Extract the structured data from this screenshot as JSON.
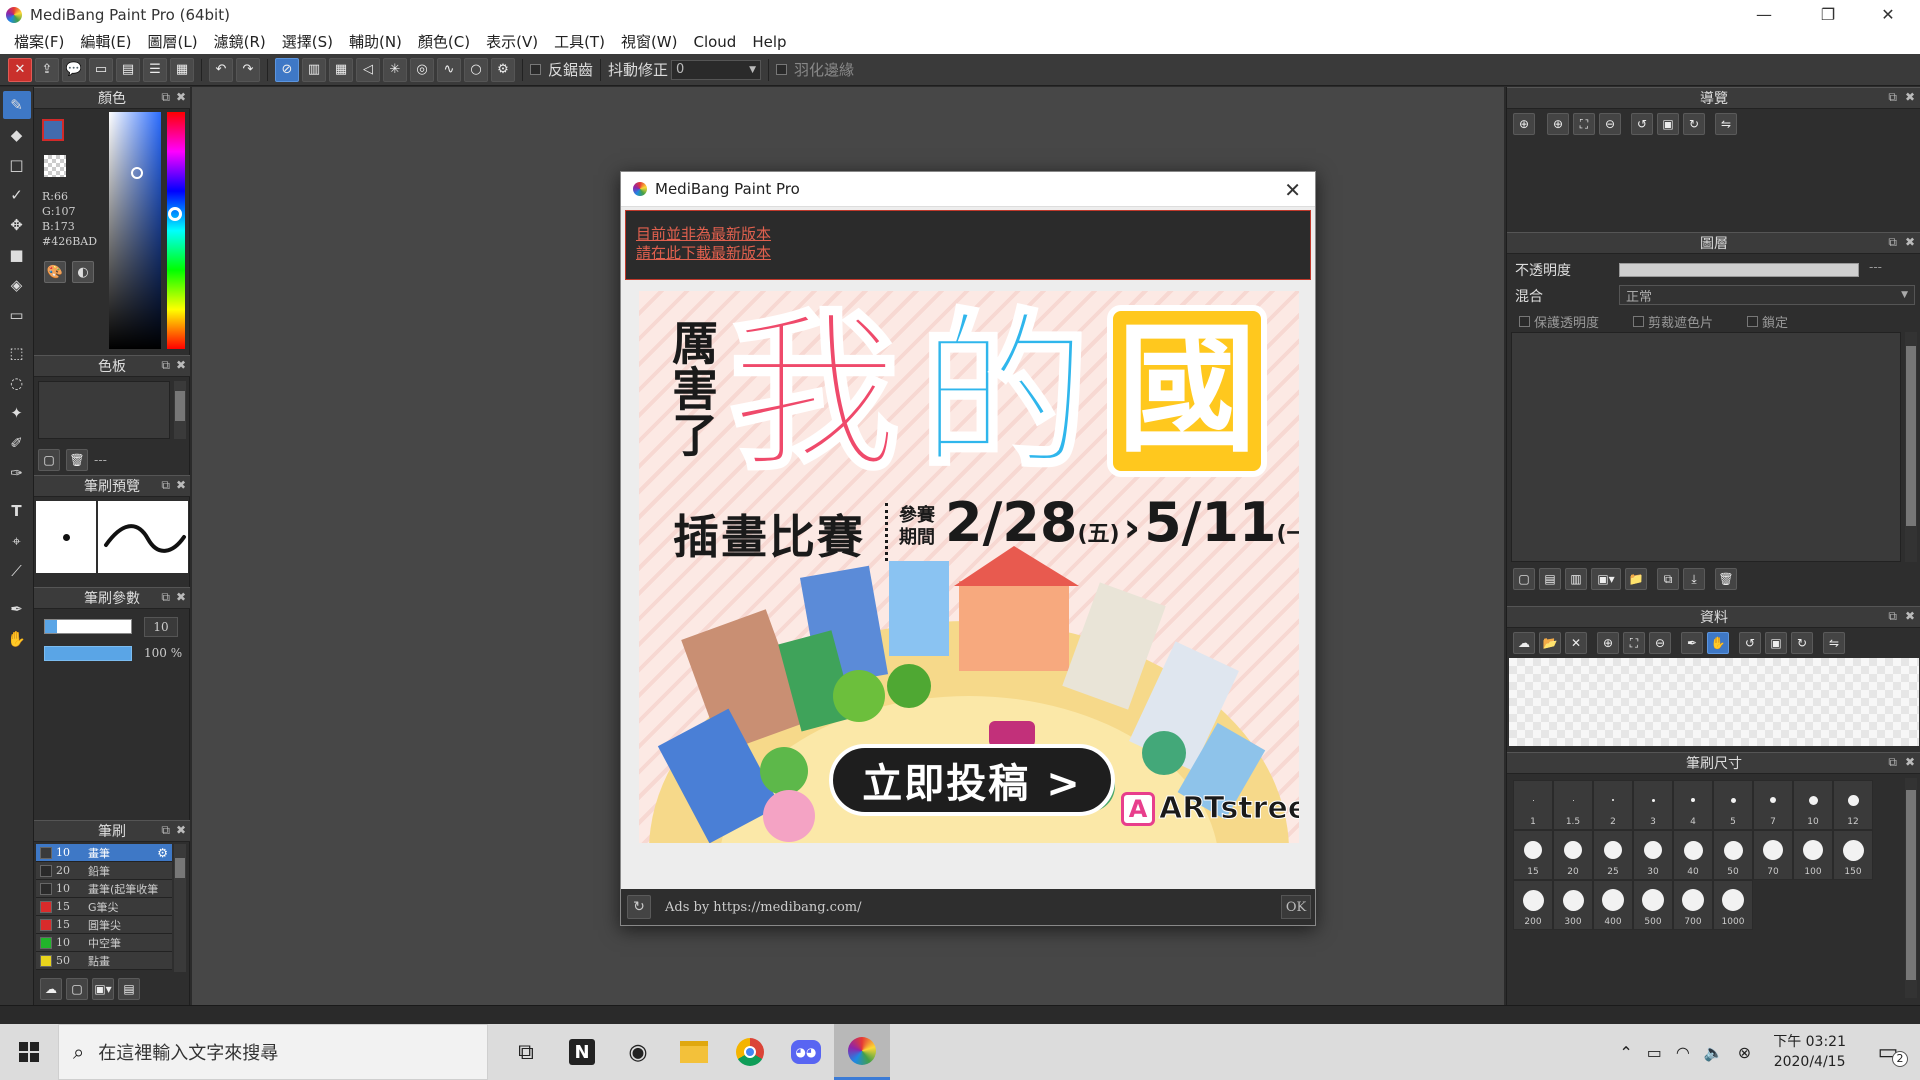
{
  "window": {
    "title": "MediBang Paint Pro (64bit)",
    "minimize": "—",
    "restore": "❐",
    "close": "✕"
  },
  "menu": [
    "檔案(F)",
    "編輯(E)",
    "圖層(L)",
    "濾鏡(R)",
    "選擇(S)",
    "輔助(N)",
    "顏色(C)",
    "表示(V)",
    "工具(T)",
    "視窗(W)",
    "Cloud",
    "Help"
  ],
  "toolbar": {
    "antialias_label": "反鋸齒",
    "stabilizer_label": "抖動修正",
    "stabilizer_value": "0",
    "feather_label": "羽化邊緣"
  },
  "panels": {
    "color": {
      "title": "顏色",
      "r": "R:66",
      "g": "G:107",
      "b": "B:173",
      "hex": "#426BAD",
      "fg_color": "#426BAD",
      "bg_color": "#d12a2a"
    },
    "palette": {
      "title": "色板",
      "dash": "---"
    },
    "brush_preview": {
      "title": "筆刷預覽"
    },
    "brush_params": {
      "title": "筆刷參數",
      "size_value": "10",
      "opacity_value": "100 %"
    },
    "brush": {
      "title": "筆刷",
      "items": [
        {
          "size": "10",
          "name": "畫筆",
          "color": "#3a3a3a",
          "selected": true
        },
        {
          "size": "20",
          "name": "鉛筆",
          "color": "#2a2a2a",
          "selected": false
        },
        {
          "size": "10",
          "name": "畫筆(起筆收筆",
          "color": "#2a2a2a",
          "selected": false
        },
        {
          "size": "15",
          "name": "G筆尖",
          "color": "#d92b2b",
          "selected": false
        },
        {
          "size": "15",
          "name": "圓筆尖",
          "color": "#d92b2b",
          "selected": false
        },
        {
          "size": "10",
          "name": "中空筆",
          "color": "#21b52b",
          "selected": false
        },
        {
          "size": "50",
          "name": "點畫",
          "color": "#e8d31c",
          "selected": false
        }
      ]
    },
    "navigator": {
      "title": "導覽"
    },
    "layer": {
      "title": "圖層",
      "opacity_label": "不透明度",
      "opacity_value": "---",
      "blend_label": "混合",
      "blend_value": "正常",
      "protect_alpha": "保護透明度",
      "clipping": "剪裁遮色片",
      "lock": "鎖定"
    },
    "material": {
      "title": "資料"
    },
    "brush_size": {
      "title": "筆刷尺寸",
      "sizes": [
        "1",
        "1.5",
        "2",
        "3",
        "4",
        "5",
        "7",
        "10",
        "12",
        "15",
        "20",
        "25",
        "30",
        "40",
        "50",
        "70",
        "100",
        "150",
        "200",
        "300",
        "400",
        "500",
        "700",
        "1000"
      ]
    }
  },
  "dialog": {
    "title": "MediBang Paint Pro",
    "notice_line1": "目前並非為最新版本",
    "notice_line2": "請在此下載最新版本",
    "footer_text": "Ads by https://medibang.com/",
    "ok_label": "OK",
    "ad": {
      "side_text": "厲害了",
      "word1": "我",
      "word2": "的",
      "word3": "國",
      "subtitle": "插畫比賽",
      "period_label1": "參賽",
      "period_label2": "期間",
      "date_start": "2/28",
      "day_start": "(五)",
      "arrow": "›",
      "date_end": "5/11",
      "day_end": "(一)",
      "cta": "立即投稿 >",
      "brand": "ARTstreet",
      "brand_mark": "A"
    }
  },
  "taskbar": {
    "search_placeholder": "在這裡輸入文字來搜尋",
    "time": "下午 03:21",
    "date": "2020/4/15",
    "notifications": "2"
  }
}
